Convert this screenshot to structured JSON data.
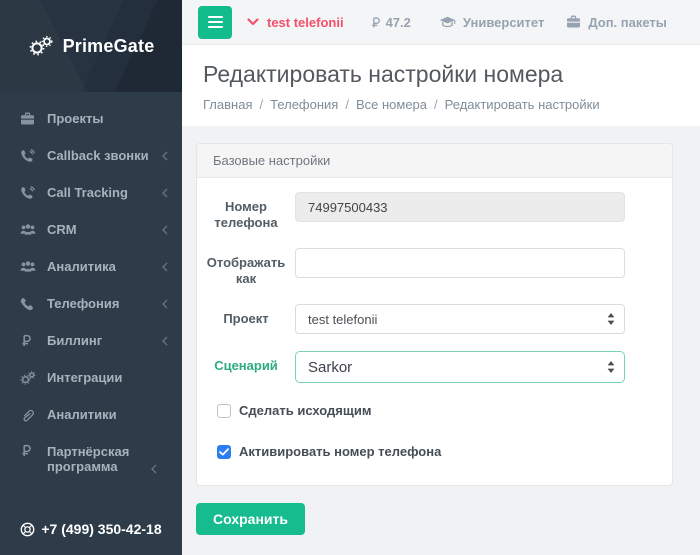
{
  "app": {
    "name": "PrimeGate"
  },
  "topbar": {
    "project_selector_label": "test telefonii",
    "balance_amount": "47.2",
    "university_label": "Университет",
    "packages_label": "Доп. пакеты"
  },
  "sidebar": {
    "items": [
      {
        "label": "Проекты",
        "icon": "briefcase-icon",
        "chevron": false
      },
      {
        "label": "Callback звонки",
        "icon": "phone-volume-icon",
        "chevron": true
      },
      {
        "label": "Call Tracking",
        "icon": "phone-volume-icon",
        "chevron": true
      },
      {
        "label": "CRM",
        "icon": "users-icon",
        "chevron": true
      },
      {
        "label": "Аналитика",
        "icon": "users-icon",
        "chevron": true
      },
      {
        "label": "Телефония",
        "icon": "phone-icon",
        "chevron": true
      },
      {
        "label": "Биллинг",
        "icon": "ruble-icon",
        "chevron": true
      },
      {
        "label": "Интеграции",
        "icon": "gears-icon",
        "chevron": false
      },
      {
        "label": "Аналитики",
        "icon": "paperclip-icon",
        "chevron": false
      },
      {
        "label": "Партнёрская программа",
        "icon": "ruble-icon",
        "chevron": true
      }
    ],
    "phone": "+7 (499) 350-42-18"
  },
  "page": {
    "title": "Редактировать настройки номера",
    "breadcrumbs": [
      "Главная",
      "Телефония",
      "Все номера",
      "Редактировать настройки"
    ]
  },
  "form": {
    "panel_title": "Базовые настройки",
    "fields": {
      "phone_number": {
        "label": "Номер телефона",
        "value": "74997500433"
      },
      "display_as": {
        "label": "Отображать как",
        "value": ""
      },
      "project": {
        "label": "Проект",
        "value": "test telefonii"
      },
      "scenario": {
        "label": "Сценарий",
        "value": "Sarkor"
      }
    },
    "checkboxes": [
      {
        "label": "Сделать исходящим",
        "checked": false
      },
      {
        "label": "Активировать номер телефона",
        "checked": true
      }
    ],
    "save_label": "Сохранить"
  },
  "colors": {
    "accent_green": "#16bc8e",
    "scenario_green": "#2cab80",
    "alert_red": "#f1516c",
    "checkbox_blue": "#2e7cf6",
    "sidebar_bg": "#2e3c49",
    "sidebar_logo_bg": "#232f3c"
  }
}
